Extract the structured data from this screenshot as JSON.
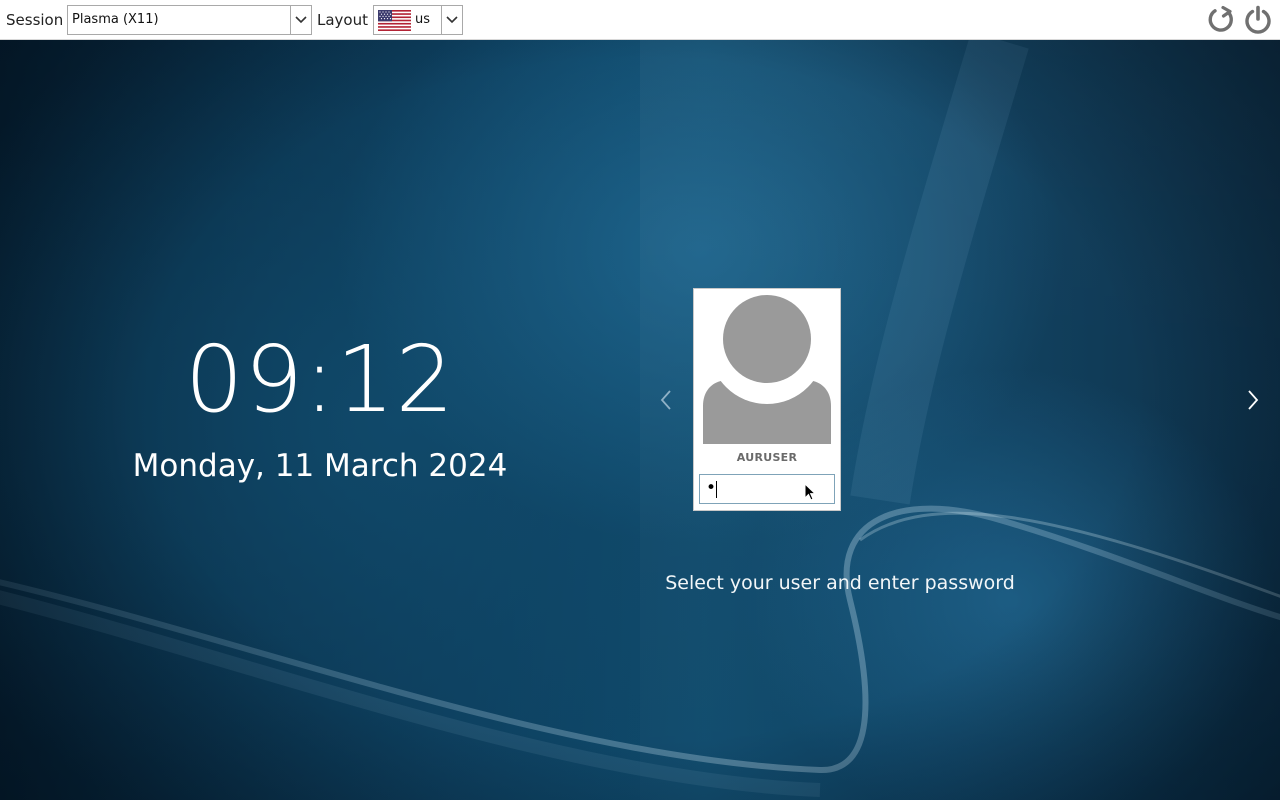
{
  "topbar": {
    "session_label": "Session",
    "session_value": "Plasma (X11)",
    "layout_label": "Layout",
    "layout_value": "us",
    "layout_flag_icon": "us-flag-icon",
    "restart_icon": "restart-icon",
    "shutdown_icon": "power-icon"
  },
  "clock": {
    "time": "09:12",
    "date": "Monday, 11 March 2024"
  },
  "login": {
    "username": "AURUSER",
    "password_masked": "•",
    "prompt": "Select your user and enter password"
  },
  "colors": {
    "topbar_bg": "#ffffff",
    "background_dark": "#062033",
    "background_accent": "#0f4b6d",
    "text_light": "#ffffff",
    "avatar_gray": "#9a9a9a"
  }
}
